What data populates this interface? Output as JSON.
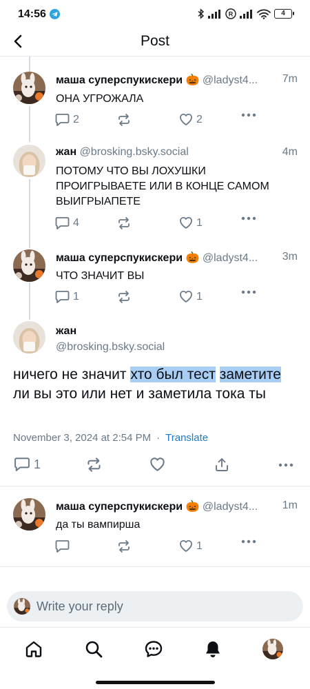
{
  "status_bar": {
    "time": "14:56",
    "battery": "4",
    "icons": [
      "telegram-icon",
      "bluetooth-icon",
      "signal-icon",
      "roaming-icon",
      "wifi-icon",
      "battery-icon"
    ]
  },
  "header": {
    "title": "Post",
    "back_icon": "chevron-left-icon"
  },
  "posts": [
    {
      "name": "маша суперспукискери 🎃",
      "handle": "@ladyst4...",
      "time": "7m",
      "text": "ОНА УГРОЖАЛА",
      "replies": "2",
      "reposts": "",
      "likes": "2"
    },
    {
      "name": "жан",
      "handle": "@brosking.bsky.social",
      "time": "4m",
      "text": "ПОТОМУ ЧТО ВЫ ЛОХУШКИ ПРОИГРЫВАЕТЕ ИЛИ В КОНЦЕ САМОМ ВЫИГРЫАПЕТЕ",
      "replies": "4",
      "reposts": "",
      "likes": "1"
    },
    {
      "name": "маша суперспукискери 🎃",
      "handle": "@ladyst4...",
      "time": "3m",
      "text": "ЧТО ЗНАЧИТ ВЫ",
      "replies": "1",
      "reposts": "",
      "likes": "1"
    }
  ],
  "main_post": {
    "name": "жан",
    "handle": "@brosking.bsky.social",
    "text_before": "ничего не значит ",
    "text_highlight_1": "хто был тест",
    "text_highlight_2": "заметите",
    "text_after": " ли вы это или нет и заметила тока ты",
    "date": "November 3, 2024 at 2:54 PM",
    "dot": "·",
    "translate": "Translate",
    "replies": "1",
    "highlight_color": "#a9cef5"
  },
  "reply_post": {
    "name": "маша суперспукискери 🎃",
    "handle": "@ladyst4...",
    "time": "1m",
    "text": "да ты вампирша",
    "replies": "",
    "reposts": "",
    "likes": "1"
  },
  "composer": {
    "placeholder": "Write your reply"
  },
  "bottom_nav": {
    "items": [
      "home-icon",
      "search-icon",
      "chat-icon",
      "notifications-icon",
      "profile-avatar"
    ]
  },
  "colors": {
    "accent": "#1c79c8",
    "muted": "#6a7987",
    "divider": "#e8ecef",
    "thread_line": "#d4dbe2"
  }
}
